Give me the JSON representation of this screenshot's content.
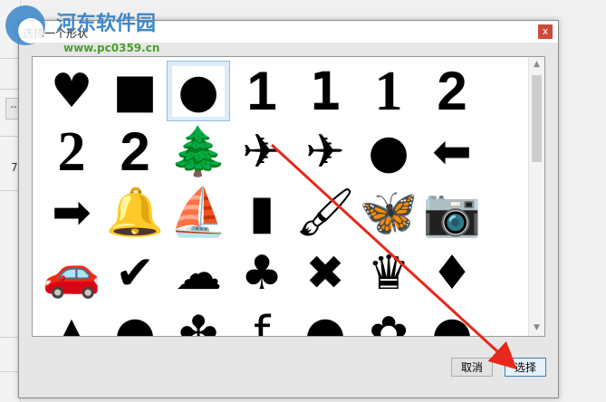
{
  "watermark": {
    "title": "河东软件园",
    "url": "www.pc0359.cn"
  },
  "background": {
    "box_label": "--",
    "partial_text": "7"
  },
  "dialog": {
    "title": "选择一个形状",
    "close_label": "x",
    "cancel_label": "取消",
    "select_label": "选择",
    "selected_index": 2
  },
  "shapes": [
    {
      "icon": "heart-icon",
      "glyph": "♥"
    },
    {
      "icon": "square-icon",
      "glyph": "■"
    },
    {
      "icon": "circle-icon",
      "glyph": "●"
    },
    {
      "icon": "digit-one-sans-icon",
      "glyph": "1"
    },
    {
      "icon": "digit-one-mono-icon",
      "glyph": "1"
    },
    {
      "icon": "digit-one-serif-icon",
      "glyph": "1"
    },
    {
      "icon": "digit-two-sans-icon",
      "glyph": "2"
    },
    {
      "icon": "digit-two-wide-icon",
      "glyph": "2"
    },
    {
      "icon": "digit-two-condensed-icon",
      "glyph": "2"
    },
    {
      "icon": "tree-icon",
      "glyph": "🌲"
    },
    {
      "icon": "airplane-tilted-icon",
      "glyph": "✈"
    },
    {
      "icon": "airplane-icon",
      "glyph": "✈"
    },
    {
      "icon": "apple-icon",
      "glyph": "●"
    },
    {
      "icon": "arrow-left-icon",
      "glyph": "⬅"
    },
    {
      "icon": "arrow-right-icon",
      "glyph": "➡"
    },
    {
      "icon": "bell-icon",
      "glyph": "🔔"
    },
    {
      "icon": "sailboat-icon",
      "glyph": "⛵"
    },
    {
      "icon": "bottle-icon",
      "glyph": "▮"
    },
    {
      "icon": "paintbrush-icon",
      "glyph": "🖌"
    },
    {
      "icon": "butterfly-icon",
      "glyph": "🦋"
    },
    {
      "icon": "camera-icon",
      "glyph": "📷"
    },
    {
      "icon": "car-icon",
      "glyph": "🚗"
    },
    {
      "icon": "checkmark-icon",
      "glyph": "✔"
    },
    {
      "icon": "cloud-icon",
      "glyph": "☁"
    },
    {
      "icon": "club-icon",
      "glyph": "♣"
    },
    {
      "icon": "cross-icon",
      "glyph": "✖"
    },
    {
      "icon": "crown-icon",
      "glyph": "♛"
    },
    {
      "icon": "diamond-icon",
      "glyph": "♦"
    },
    {
      "icon": "spade-icon",
      "glyph": "▲"
    },
    {
      "icon": "partial-shape-icon",
      "glyph": "●"
    },
    {
      "icon": "partial-shape-icon",
      "glyph": "✤"
    },
    {
      "icon": "facebook-icon",
      "glyph": "f"
    },
    {
      "icon": "fish-icon",
      "glyph": "●"
    },
    {
      "icon": "flower-icon",
      "glyph": "✿"
    },
    {
      "icon": "partial-shape-icon",
      "glyph": "●"
    }
  ],
  "colors": {
    "arrow": "#e8281b",
    "selection": "#dcecf9",
    "close": "#c94c3a"
  }
}
